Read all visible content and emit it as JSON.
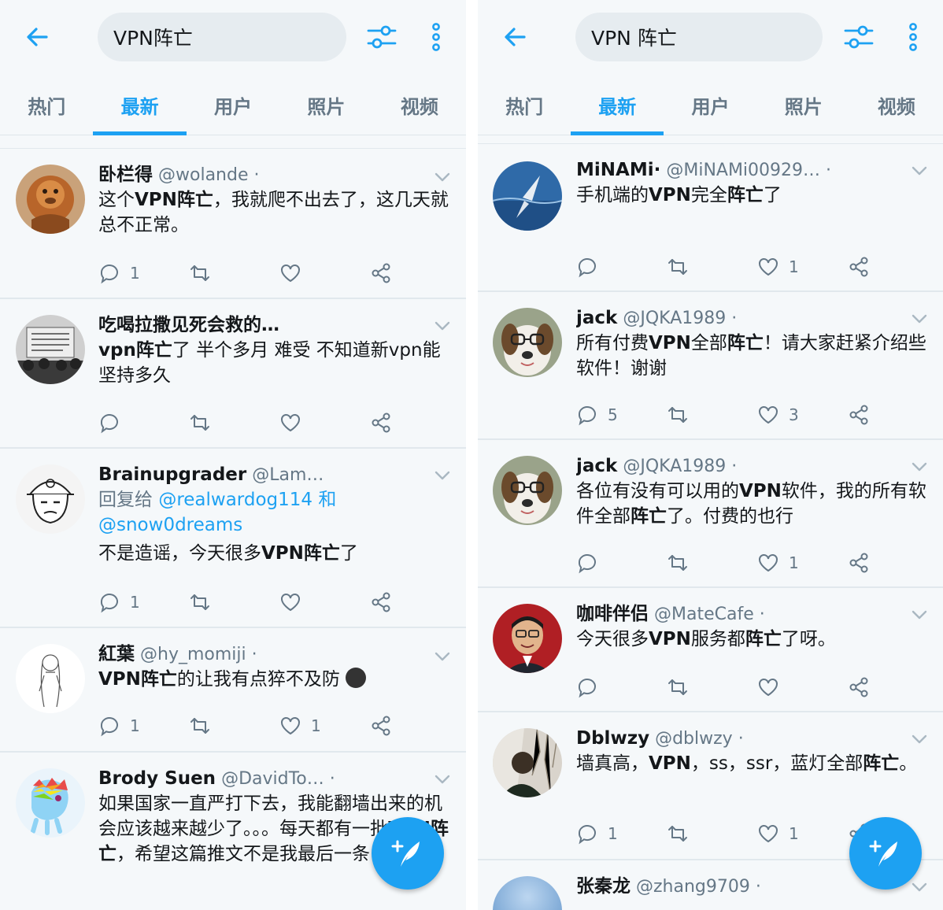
{
  "accent": "#1da1f2",
  "left": {
    "search_value": "VPN阵亡",
    "tabs": [
      "热门",
      "最新",
      "用户",
      "照片",
      "视频"
    ],
    "tweets": [
      {
        "name": "卧栏得",
        "handle": "@wolande",
        "body_pre": "这个",
        "body_bold": "VPN阵亡",
        "body_post": "，我就爬不出去了，这几天就总不正常。",
        "reply_count": "1",
        "like_count": ""
      },
      {
        "name": "吃喝拉撒见死会救的…",
        "body_bold": "vpn阵亡",
        "body_post": "了 半个多月 难受 不知道新vpn能坚持多久",
        "reply_count": "",
        "like_count": ""
      },
      {
        "name": "Brainupgrader",
        "handle": "@Lam…",
        "reply_label": "回复给",
        "reply_to_1": "@realwardog114 和",
        "reply_to_2": "@snow0dreams",
        "body_pre": "不是造谣，今天很多",
        "body_bold": "VPN阵亡",
        "body_post": "了",
        "reply_count": "1",
        "like_count": ""
      },
      {
        "name": "紅葉",
        "handle": "@hy_momiji",
        "body_bold": "VPN阵亡",
        "body_post": "的让我有点猝不及防",
        "reply_count": "1",
        "like_count": "1"
      },
      {
        "name": "Brody Suen",
        "handle": "@DavidTo…",
        "body_pre": "如果国家一直严打下去，我能翻墙出来的机会应该越来越少了。。。每天都有一批",
        "body_bold": "VPN阵亡",
        "body_post": "，希望这篇推文不是我最后一条"
      }
    ]
  },
  "right": {
    "search_value": "VPN 阵亡",
    "tabs": [
      "热门",
      "最新",
      "用户",
      "照片",
      "视频"
    ],
    "tweets": [
      {
        "name": "MiNAMi·",
        "handle": "@MiNAMi00929…",
        "body_pre": "手机端的",
        "body_bold": "VPN",
        "body_mid": "完全",
        "body_bold2": "阵亡",
        "body_post": "了",
        "reply_count": "",
        "like_count": "1"
      },
      {
        "name": "jack",
        "handle": "@JQKA1989",
        "body_pre": "所有付费",
        "body_bold": "VPN",
        "body_mid": "全部",
        "body_bold2": "阵亡",
        "body_post": "！请大家赶紧介绍些软件！谢谢",
        "reply_count": "5",
        "like_count": "3"
      },
      {
        "name": "jack",
        "handle": "@JQKA1989",
        "body_pre": "各位有没有可以用的",
        "body_bold": "VPN",
        "body_mid": "软件，我的所有软件全部",
        "body_bold2": "阵亡",
        "body_post": "了。付费的也行",
        "reply_count": "",
        "like_count": "1"
      },
      {
        "name": "咖啡伴侣",
        "handle": "@MateCafe",
        "body_pre": "今天很多",
        "body_bold": "VPN",
        "body_mid": "服务都",
        "body_bold2": "阵亡",
        "body_post": "了呀。",
        "reply_count": "",
        "like_count": ""
      },
      {
        "name": "Dblwzy",
        "handle": "@dblwzy",
        "body_pre": "墙真高，",
        "body_bold": "VPN",
        "body_mid": "，ss，ssr，蓝灯全部",
        "body_bold2": "阵亡",
        "body_post": "。",
        "reply_count": "1",
        "like_count": "1"
      },
      {
        "name": "张秦龙",
        "handle": "@zhang9709"
      }
    ]
  }
}
